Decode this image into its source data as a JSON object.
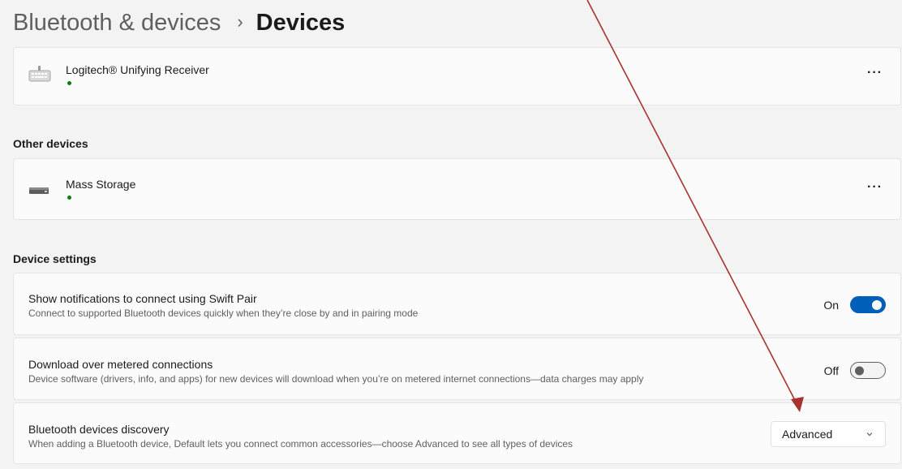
{
  "breadcrumb": {
    "parent": "Bluetooth & devices",
    "separator": "›",
    "current": "Devices"
  },
  "input_devices": {
    "items": [
      {
        "name": "Logitech® Unifying Receiver",
        "icon": "keyboard-icon",
        "status": "connected"
      }
    ]
  },
  "other_devices": {
    "title": "Other devices",
    "items": [
      {
        "name": "Mass Storage",
        "icon": "drive-icon",
        "status": "connected"
      }
    ]
  },
  "device_settings": {
    "title": "Device settings",
    "swift_pair": {
      "title": "Show notifications to connect using Swift Pair",
      "description": "Connect to supported Bluetooth devices quickly when they’re close by and in pairing mode",
      "state_label": "On",
      "enabled": true
    },
    "metered": {
      "title": "Download over metered connections",
      "description": "Device software (drivers, info, and apps) for new devices will download when you’re on metered internet connections—data charges may apply",
      "state_label": "Off",
      "enabled": false
    },
    "discovery": {
      "title": "Bluetooth devices discovery",
      "description": "When adding a Bluetooth device, Default lets you connect common accessories—choose Advanced to see all types of devices",
      "selected": "Advanced"
    }
  },
  "more_label": "···",
  "colors": {
    "accent": "#005fb8",
    "status_green": "#0f7b0f",
    "annotation_arrow": "#a8322d"
  }
}
